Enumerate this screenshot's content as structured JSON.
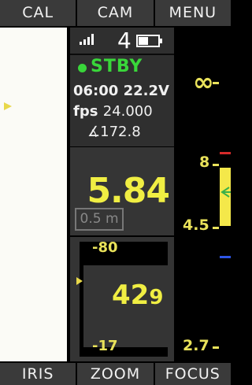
{
  "top_tabs": [
    "CAL",
    "CAM",
    "MENU"
  ],
  "bottom_tabs": [
    "IRIS",
    "ZOOM",
    "FOCUS"
  ],
  "status": {
    "channel": "4",
    "record_state": "STBY",
    "timecode": "06:00",
    "voltage": "22.2V",
    "fps_label": "fps",
    "fps_value": "24.000",
    "shutter_symbol": "∡",
    "shutter_value": "172.8",
    "signal_icon": "signal-bars-icon",
    "battery_icon": "battery-icon"
  },
  "focus_readout": {
    "distance": "5.84",
    "lens_limit": "0.5 m"
  },
  "zoom_readout": {
    "max": "80",
    "min": "17",
    "value": "42",
    "value_decimal": "9"
  },
  "focus_scale": {
    "marks": [
      "∞",
      "8",
      "4.5",
      "2.7"
    ]
  },
  "colors": {
    "accent_yellow": "#f0ee43",
    "record_green": "#39d63a",
    "red_marker": "#d52a2a",
    "blue_marker": "#2e55e6"
  }
}
